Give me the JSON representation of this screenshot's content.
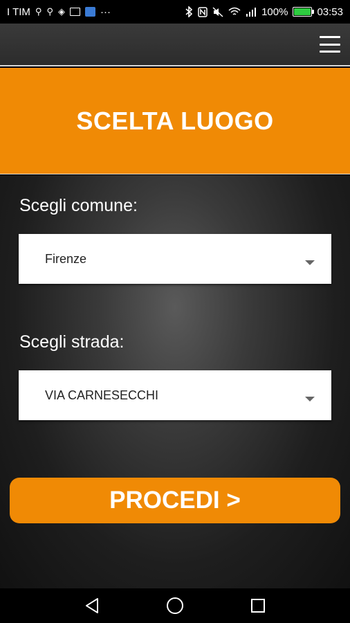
{
  "status_bar": {
    "carrier": "I TIM",
    "more_indicator": "···",
    "battery_percent": "100%",
    "time": "03:53",
    "battery_level": 1.0,
    "battery_color": "#2ecc40"
  },
  "app_bar": {
    "menu_icon": "hamburger-menu-icon"
  },
  "banner": {
    "title": "SCELTA LUOGO",
    "color": "#f08a05"
  },
  "form": {
    "comune": {
      "label": "Scegli comune:",
      "selected": "Firenze"
    },
    "strada": {
      "label": "Scegli strada:",
      "selected": "VIA CARNESECCHI"
    },
    "proceed_label": "PROCEDI >"
  },
  "nav_bar": {
    "back_icon": "back-triangle-icon",
    "home_icon": "home-circle-icon",
    "recents_icon": "recents-square-icon"
  }
}
